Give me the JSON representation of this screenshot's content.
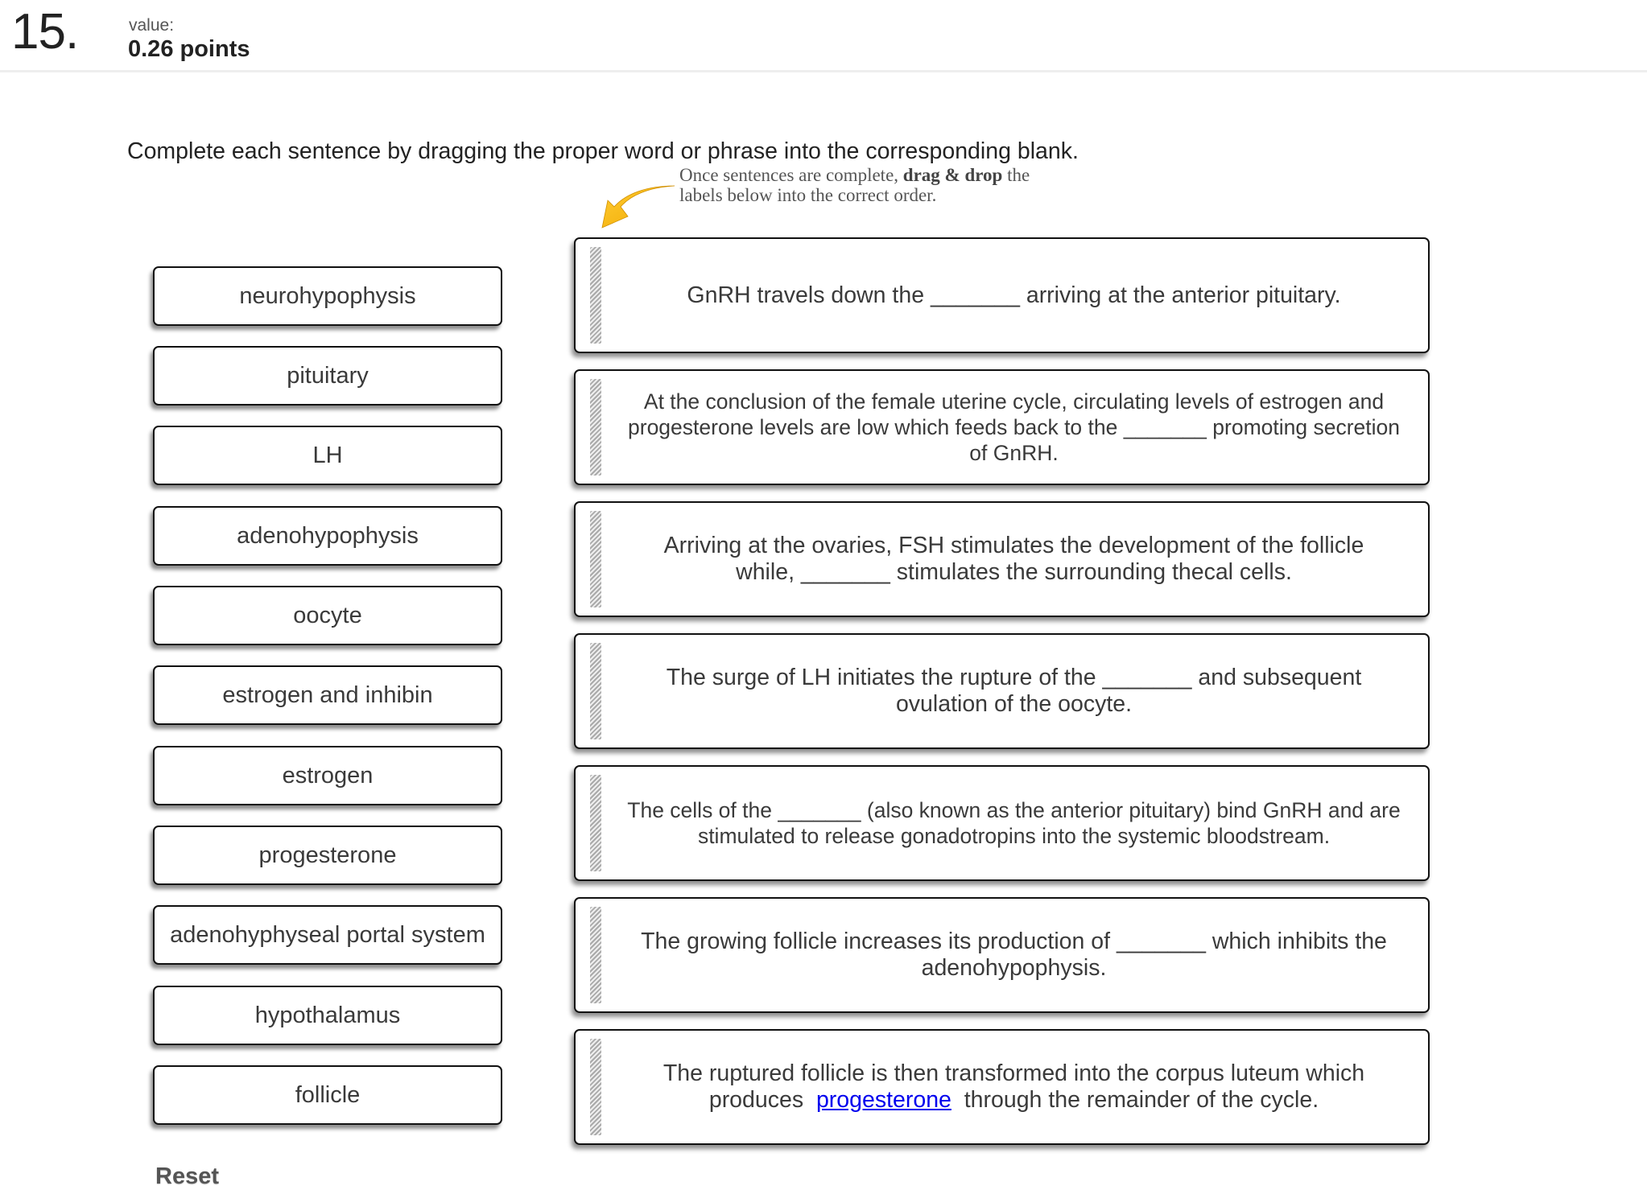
{
  "question": {
    "number": "15.",
    "value_label": "value:",
    "value_points": "0.26 points"
  },
  "instruction": "Complete each sentence by dragging the proper word or phrase into the corresponding blank.",
  "hint": {
    "line1_pre": "Once sentences are complete,",
    "line1_bold": "drag & drop",
    "line1_post": "the",
    "line2": "labels below into the correct order.",
    "arrow_icon": "curved-arrow-down-left",
    "arrow_color": "#f5b400"
  },
  "labels": [
    "neurohypophysis",
    "pituitary",
    "LH",
    "adenohypophysis",
    "oocyte",
    "estrogen and inhibin",
    "estrogen",
    "progesterone",
    "adenohyphyseal portal system",
    "hypothalamus",
    "follicle"
  ],
  "sentences": [
    {
      "text": "GnRH travels down the _______ arriving at the anterior pituitary."
    },
    {
      "text": "At the conclusion of the female uterine cycle, circulating levels of estrogen and progesterone levels are low which feeds back to the _______ promoting secretion of GnRH."
    },
    {
      "text": "Arriving at the ovaries, FSH stimulates the development of the follicle while, _______ stimulates the surrounding thecal cells."
    },
    {
      "text": "The surge of LH initiates the rupture of the _______ and subsequent ovulation of the oocyte."
    },
    {
      "text": "The cells of the _______ (also known as the anterior pituitary) bind GnRH and are stimulated to release gonadotropins into the systemic bloodstream."
    },
    {
      "text": "The growing follicle increases its production of _______ which inhibits the adenohypophysis."
    },
    {
      "text_pre": "The ruptured follicle is then transformed into the corpus luteum which produces",
      "link": "progesterone",
      "text_post": "through the remainder of the cycle."
    }
  ],
  "reset_label": "Reset",
  "colors": {
    "link": "#0000ee",
    "box_border": "#111111"
  }
}
